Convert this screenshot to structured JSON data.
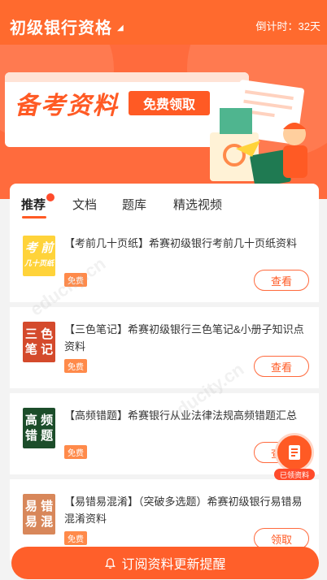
{
  "header": {
    "title": "初级银行资格",
    "countdown": "倒计时：32天"
  },
  "banner": {
    "headline": "备考资料",
    "free_label": "免费领取"
  },
  "tabs": [
    {
      "label": "推荐"
    },
    {
      "label": "文档"
    },
    {
      "label": "题库"
    },
    {
      "label": "精选视频"
    }
  ],
  "items": [
    {
      "cover_l1": "考 前",
      "cover_l2": "几十页纸",
      "text": "【考前几十页纸】希赛初级银行考前几十页纸资料",
      "badge": "免费",
      "btn": "查看",
      "cover_color": "#ffd33a"
    },
    {
      "cover_l1": "三 色",
      "cover_l2": "笔 记",
      "text": "【三色笔记】希赛初级银行三色笔记&小册子知识点资料",
      "badge": "免费",
      "btn": "查看",
      "cover_color": "#d44a2c"
    },
    {
      "cover_l1": "高 频",
      "cover_l2": "错 题",
      "text": "【高频错题】希赛银行从业法律法规高频错题汇总",
      "badge": "免费",
      "btn": "查看",
      "cover_color": "#1c4d2a"
    },
    {
      "cover_l1": "易 错",
      "cover_l2": "易 混",
      "text": "【易错易混淆】（突破多选题）希赛初级银行易错易混淆资料",
      "badge": "免费",
      "btn": "领取",
      "cover_color": "#d8875a"
    }
  ],
  "float": {
    "label": "已领资料"
  },
  "bottom": {
    "label": "订阅资料更新提醒"
  },
  "colors": {
    "accent": "#ff5f2a"
  }
}
